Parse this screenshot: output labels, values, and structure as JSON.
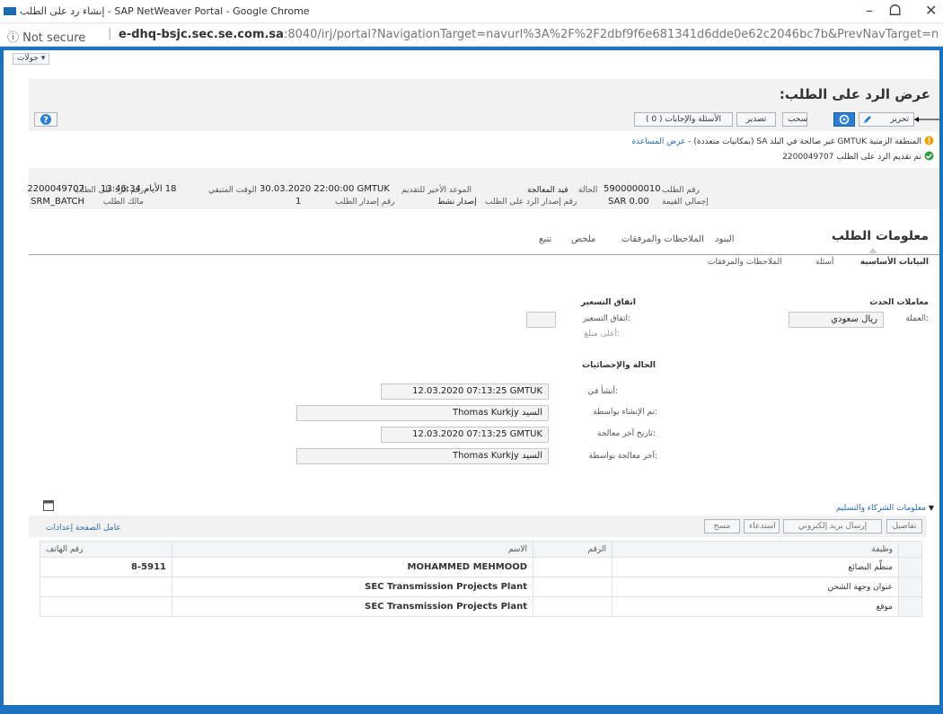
{
  "window": {
    "title": "إنشاء رد على الطلب - SAP NetWeaver Portal - Google Chrome",
    "minimize": "–",
    "restore": "ᗝ",
    "close": "✕"
  },
  "address": {
    "security": "ⓘ Not secure",
    "separator": "|",
    "url_host": "e-dhq-bsjc.sec.se.com.sa",
    "url_rest": ":8040/irj/portal?NavigationTarget=navurl%3A%2F%2F2dbf9f6e681341d6dde0e62c2046bc7b&PrevNavTarget=navurl..."
  },
  "portal": {
    "favorites_label": "جولات ▾"
  },
  "page": {
    "title": "عرض الرد على الطلب:",
    "toolbar": {
      "edit": "تحرير",
      "withdraw": "سحب",
      "export": "تصدير",
      "questions_answers": "الأسئلة والإجابات ( 0 )",
      "help_icon": "?"
    },
    "messages": {
      "warning_text": "المنطقة الزمنية GMTUK غير صالحة في البلد SA (بمكانيات متعددة) - ",
      "warning_link": "عرض المساعدة",
      "success_text": "تم تقديم الرد على الطلب 2200049707"
    },
    "header": {
      "response_no_label": "رقم الرد على الطلب",
      "response_no": "2200049707",
      "request_owner_label": "مالك الطلب",
      "request_owner": "SRM_BATCH",
      "request_no_label": "رقم الطلب",
      "request_no": "5900000010",
      "total_value_label": "إجمالي القيمة",
      "total_value": "SAR 0.00",
      "status_label": "الحالة",
      "status": "قيد المعالجة",
      "response_version_label": "رقم إصدار الرد على الطلب",
      "active_version": "إصدار نشط",
      "deadline_label": "الموعد الأخير للتقديم",
      "deadline": "30.03.2020 22:00:00 GMTUK",
      "request_version_label": "رقم إصدار الطلب",
      "request_version": "1",
      "remaining_time_label": "الوقت المتبقي",
      "remaining_time": "18 الأيام 13:46:34"
    },
    "tabs": {
      "request_info": "معلومات الطلب",
      "items": "البنود",
      "notes_attachments": "الملاحظات والمرفقات",
      "summary": "ملخص",
      "tracking": "تتبع"
    },
    "subtabs": {
      "basic_data": "البيانات الأساسية",
      "questions": "أسئلة",
      "notes_attachments": "الملاحظات والمرفقات"
    },
    "event_params": {
      "heading": "معاملات الحدث",
      "currency_label": "العملة:",
      "currency": "ريال سعودي"
    },
    "pricing": {
      "heading": "اتفاق التسعير",
      "pricing_label": "اتفاق التسعير:",
      "max_amount_label": "أعلى مبلغ:"
    },
    "status_stats": {
      "heading": "الحالة والإحصائيات",
      "created_on_label": "أنشأ في:",
      "created_on": "12.03.2020 07:13:25 GMTUK",
      "created_by_label": "تم الإنشاء بواسطة:",
      "created_by": "السيد Thomas Kurkjy",
      "last_processed_date_label": "تاريخ آخر معالجة:",
      "last_processed_date": "12.03.2020 07:13:25 GMTUK",
      "last_processed_by_label": "آخر معالجة بواسطة:",
      "last_processed_by": "السيد Thomas Kurkjy"
    },
    "partners": {
      "section_title": "معلومات الشركاء والتسليم",
      "buttons": {
        "details": "تفاصيل",
        "send_email": "إرسال بريد إلكتروني",
        "call": "استدعاء",
        "clear": "مسح"
      },
      "table_settings": "عامل الصفحة إعدادات",
      "columns": [
        "وظيفة",
        "الرقم",
        "الاسم",
        "رقم الهاتف"
      ],
      "rows": [
        [
          "منظِّم البضائع",
          "",
          "MOHAMMED MEHMOOD",
          "8-5911"
        ],
        [
          "عنوان وجهة الشحن",
          "",
          "SEC Transmission Projects Plant",
          ""
        ],
        [
          "موقع",
          "",
          "SEC Transmission Projects Plant",
          ""
        ]
      ]
    }
  }
}
